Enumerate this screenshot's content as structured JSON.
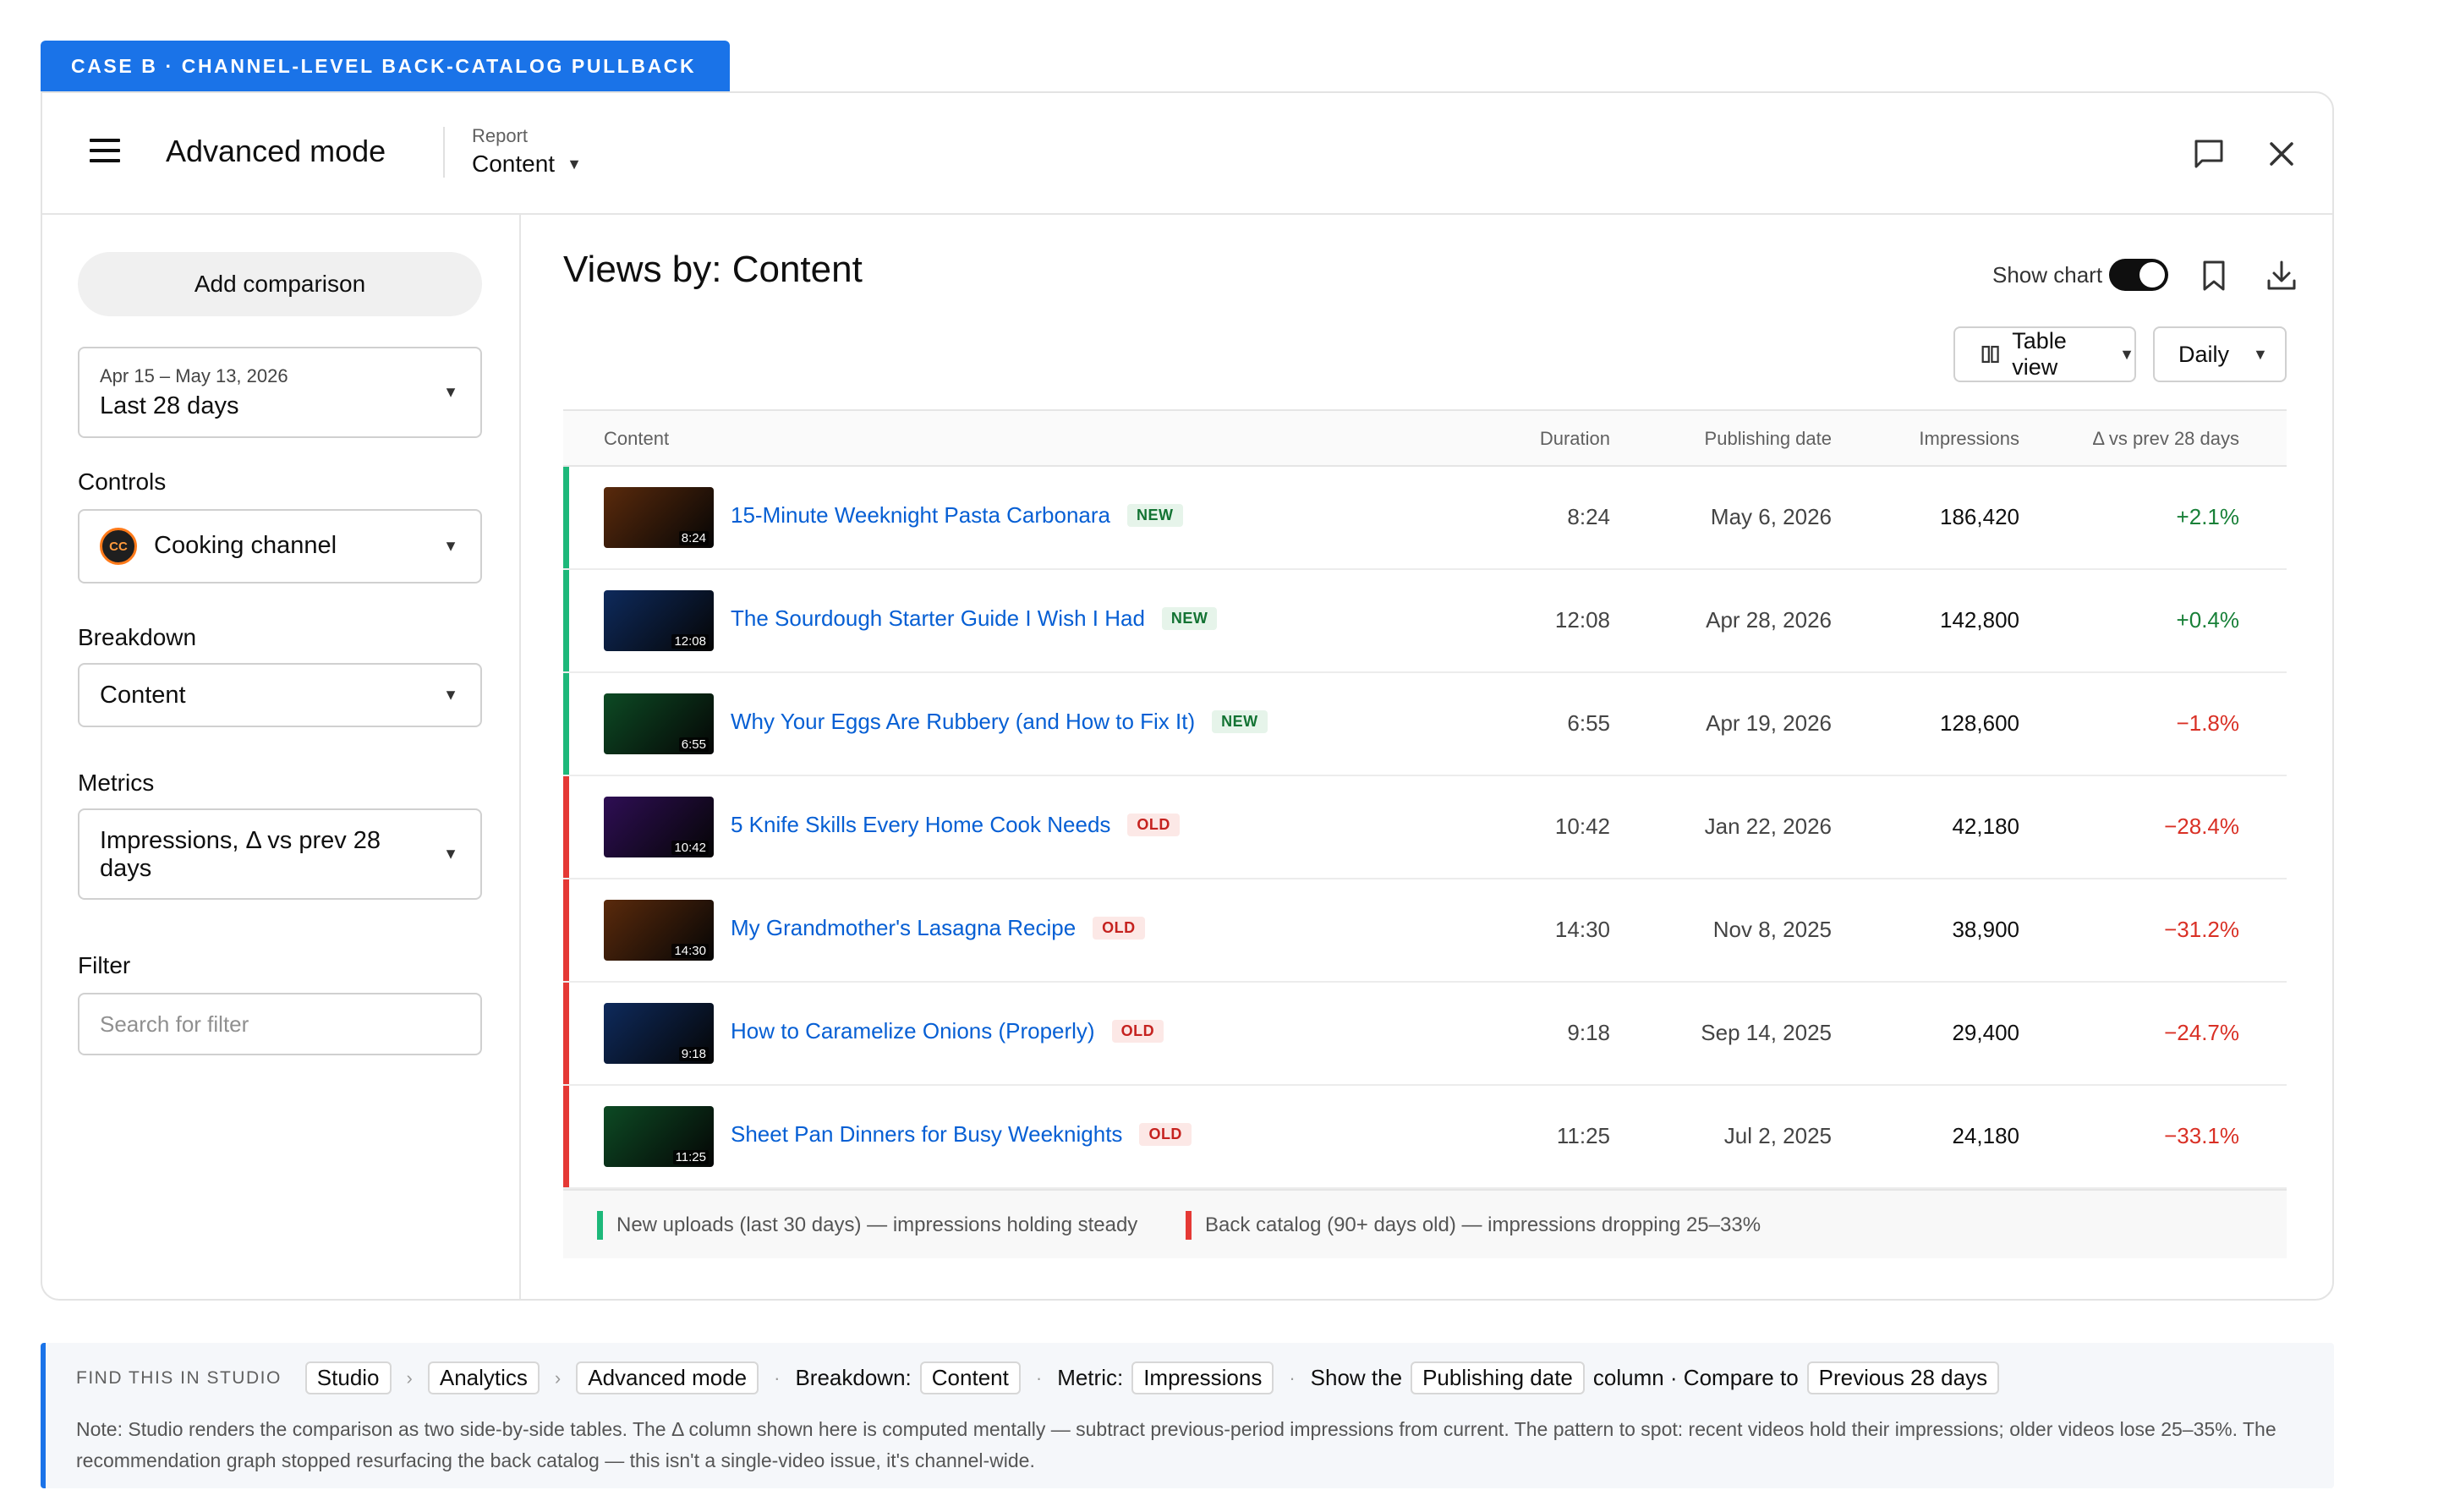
{
  "case_tag": "CASE B · CHANNEL-LEVEL BACK-CATALOG PULLBACK",
  "header": {
    "app_title": "Advanced mode",
    "report_label": "Report",
    "report_value": "Content"
  },
  "sidebar": {
    "add_comparison": "Add comparison",
    "date_range": "Apr 15 – May 13, 2026",
    "date_value": "Last 28 days",
    "controls_label": "Controls",
    "controls_avatar": "CC",
    "controls_value": "Cooking channel",
    "breakdown_label": "Breakdown",
    "breakdown_value": "Content",
    "metrics_label": "Metrics",
    "metrics_value": "Impressions, Δ vs prev 28 days",
    "filter_label": "Filter",
    "filter_placeholder": "Search for filter"
  },
  "main": {
    "title": "Views by: Content",
    "show_chart_label": "Show chart",
    "show_chart_on": true,
    "table_view_label": "Table view",
    "interval_label": "Daily"
  },
  "table": {
    "columns": {
      "content": "Content",
      "duration": "Duration",
      "publishing_date": "Publishing date",
      "impressions": "Impressions",
      "delta": "Δ vs prev 28 days"
    },
    "rows": [
      {
        "title": "15-Minute Weeknight Pasta Carbonara",
        "badge": "NEW",
        "duration": "8:24",
        "date": "May 6, 2026",
        "impressions": "186,420",
        "delta": "+2.1%",
        "thumb_color": "#5a2a0c"
      },
      {
        "title": "The Sourdough Starter Guide I Wish I Had",
        "badge": "NEW",
        "duration": "12:08",
        "date": "Apr 28, 2026",
        "impressions": "142,800",
        "delta": "+0.4%",
        "thumb_color": "#0e2a5c"
      },
      {
        "title": "Why Your Eggs Are Rubbery (and How to Fix It)",
        "badge": "NEW",
        "duration": "6:55",
        "date": "Apr 19, 2026",
        "impressions": "128,600",
        "delta": "−1.8%",
        "thumb_color": "#0d4a24"
      },
      {
        "title": "5 Knife Skills Every Home Cook Needs",
        "badge": "OLD",
        "duration": "10:42",
        "date": "Jan 22, 2026",
        "impressions": "42,180",
        "delta": "−28.4%",
        "thumb_color": "#2e0e54"
      },
      {
        "title": "My Grandmother's Lasagna Recipe",
        "badge": "OLD",
        "duration": "14:30",
        "date": "Nov 8, 2025",
        "impressions": "38,900",
        "delta": "−31.2%",
        "thumb_color": "#5a2a0c"
      },
      {
        "title": "How to Caramelize Onions (Properly)",
        "badge": "OLD",
        "duration": "9:18",
        "date": "Sep 14, 2025",
        "impressions": "29,400",
        "delta": "−24.7%",
        "thumb_color": "#0e2a5c"
      },
      {
        "title": "Sheet Pan Dinners for Busy Weeknights",
        "badge": "OLD",
        "duration": "11:25",
        "date": "Jul 2, 2025",
        "impressions": "24,180",
        "delta": "−33.1%",
        "thumb_color": "#0d4a24"
      }
    ],
    "legend": {
      "new": "New uploads (last 30 days) — impressions holding steady",
      "old": "Back catalog (90+ days old) — impressions dropping 25–33%"
    }
  },
  "colors": {
    "accent": "#1a73e8",
    "new_bar": "#1db87a",
    "old_bar": "#e53935",
    "link": "#065fd4",
    "positive": "#188038",
    "negative": "#d93025"
  },
  "find": {
    "label": "FIND THIS IN STUDIO",
    "crumb1": "Studio",
    "crumb2": "Analytics",
    "crumb3": "Advanced mode",
    "breakdown_text": "Breakdown:",
    "breakdown_chip": "Content",
    "metric_text": "Metric:",
    "metric_chip": "Impressions",
    "show_text": "Show the",
    "show_chip": "Publishing date",
    "column_text": "column · Compare to",
    "compare_chip": "Previous 28 days",
    "note": "Note: Studio renders the comparison as two side-by-side tables. The Δ column shown here is computed mentally — subtract previous-period impressions from current. The pattern to spot: recent videos hold their impressions; older videos lose 25–35%. The recommendation graph stopped resurfacing the back catalog — this isn't a single-video issue, it's channel-wide."
  }
}
